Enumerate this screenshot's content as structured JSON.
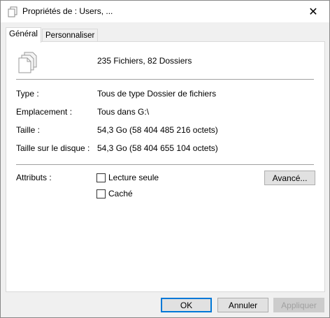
{
  "window": {
    "title": "Propriétés de : Users, ...",
    "close_label": "✕"
  },
  "tabs": [
    {
      "label": "Général",
      "active": true
    },
    {
      "label": "Personnaliser",
      "active": false
    }
  ],
  "general": {
    "summary": "235 Fichiers, 82 Dossiers",
    "fields": [
      {
        "label": "Type :",
        "value": "Tous de type Dossier de fichiers"
      },
      {
        "label": "Emplacement :",
        "value": "Tous dans G:\\"
      },
      {
        "label": "Taille :",
        "value": "54,3 Go (58 404 485 216 octets)"
      },
      {
        "label": "Taille sur le disque :",
        "value": "54,3 Go (58 404 655 104 octets)"
      }
    ],
    "attributes_label": "Attributs :",
    "attributes": [
      {
        "label": "Lecture seule",
        "checked": false
      },
      {
        "label": "Caché",
        "checked": false
      }
    ],
    "advanced_label": "Avancé..."
  },
  "buttons": {
    "ok": "OK",
    "cancel": "Annuler",
    "apply": "Appliquer"
  }
}
